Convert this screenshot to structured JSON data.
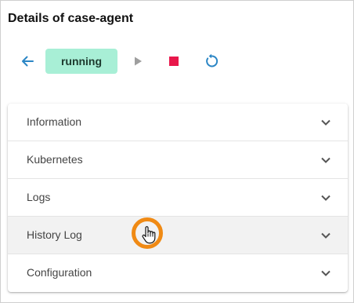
{
  "header": {
    "title": "Details of case-agent"
  },
  "toolbar": {
    "back_icon": "arrow-left-icon",
    "status": "running",
    "play_icon": "play-icon",
    "stop_icon": "stop-icon",
    "restart_icon": "restart-icon"
  },
  "colors": {
    "accent": "#2b86c5",
    "status_bg": "#a8efd6",
    "stop": "#e8174b",
    "play_disabled": "#9e9e9e",
    "cursor_ring": "#f08a14"
  },
  "sections": [
    {
      "label": "Information"
    },
    {
      "label": "Kubernetes"
    },
    {
      "label": "Logs"
    },
    {
      "label": "History Log"
    },
    {
      "label": "Configuration"
    }
  ],
  "cursor": {
    "icon": "hand-pointer-icon"
  }
}
